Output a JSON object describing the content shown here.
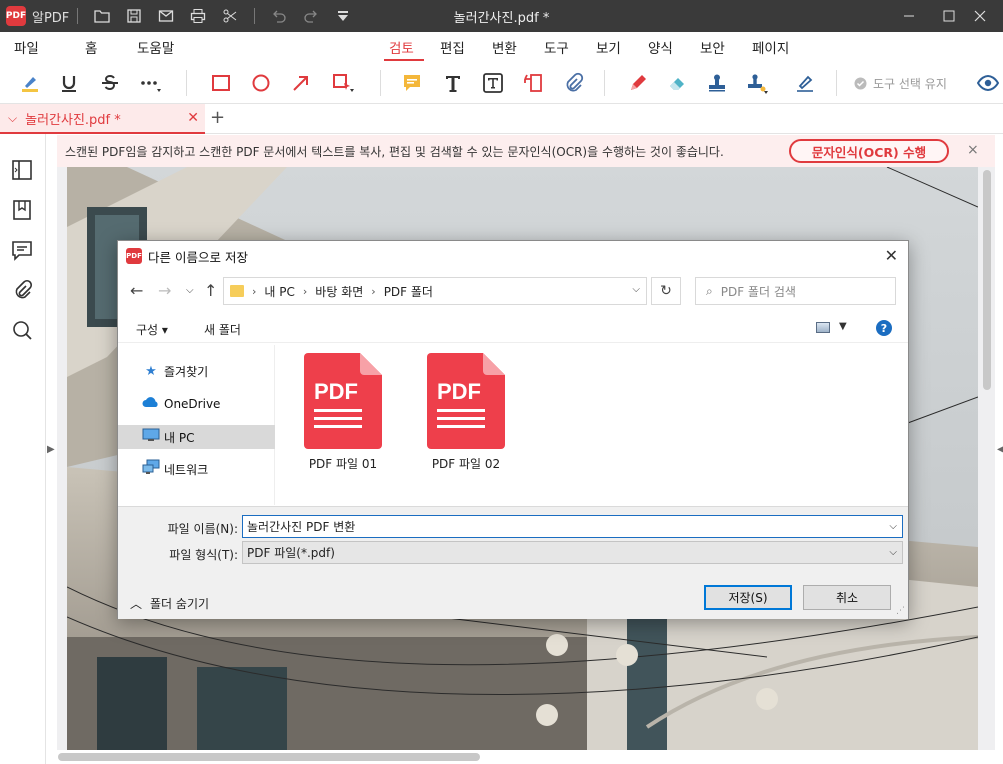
{
  "titlebar": {
    "app_name": "알PDF",
    "doc_title": "놀러간사진.pdf *",
    "logo_text": "PDF"
  },
  "menu": {
    "items": [
      {
        "label": "파일",
        "active": false
      },
      {
        "label": "홈",
        "active": false
      },
      {
        "label": "도움말",
        "active": false
      },
      {
        "label": "검토",
        "active": true
      },
      {
        "label": "편집",
        "active": false
      },
      {
        "label": "변환",
        "active": false
      },
      {
        "label": "도구",
        "active": false
      },
      {
        "label": "보기",
        "active": false
      },
      {
        "label": "양식",
        "active": false
      },
      {
        "label": "보안",
        "active": false
      },
      {
        "label": "페이지",
        "active": false
      }
    ]
  },
  "toolbar": {
    "keep_tool_label": "도구 선택 유지"
  },
  "tabs": {
    "active_doc": "놀러간사진.pdf *",
    "add_label": "+"
  },
  "notice": {
    "text": "스캔된 PDF임을 감지하고 스캔한 PDF 문서에서 텍스트를 복사, 편집 및 검색할 수 있는 문자인식(OCR)을 수행하는 것이 좋습니다.",
    "button_label": "문자인식(OCR) 수행",
    "close": "×"
  },
  "dialog": {
    "title": "다른 이름으로 저장",
    "logo_text": "PDF",
    "breadcrumb": [
      "내 PC",
      "바탕 화면",
      "PDF 폴더"
    ],
    "search_placeholder": "PDF 폴더 검색",
    "organize_label": "구성 ▾",
    "new_folder_label": "새 폴더",
    "help_label": "?",
    "nav_items": [
      {
        "label": "즐겨찾기",
        "icon": "star-icon"
      },
      {
        "label": "OneDrive",
        "icon": "cloud-icon"
      },
      {
        "label": "내 PC",
        "icon": "computer-icon",
        "selected": true
      },
      {
        "label": "네트워크",
        "icon": "network-icon"
      }
    ],
    "files": [
      {
        "name": "PDF 파일 01",
        "badge": "PDF"
      },
      {
        "name": "PDF 파일 02",
        "badge": "PDF"
      }
    ],
    "filename_label": "파일 이름(N):",
    "filename_value": "놀러간사진 PDF 변환",
    "filetype_label": "파일 형식(T):",
    "filetype_value": "PDF 파일(*.pdf)",
    "hide_folders_label": "폴더 숨기기",
    "save_label": "저장(S)",
    "cancel_label": "취소"
  },
  "colors": {
    "accent": "#e03a3e",
    "titlebar": "#3a3a3a",
    "notice_bg": "#fdeeee",
    "pdf_icon": "#ee3f4b"
  }
}
